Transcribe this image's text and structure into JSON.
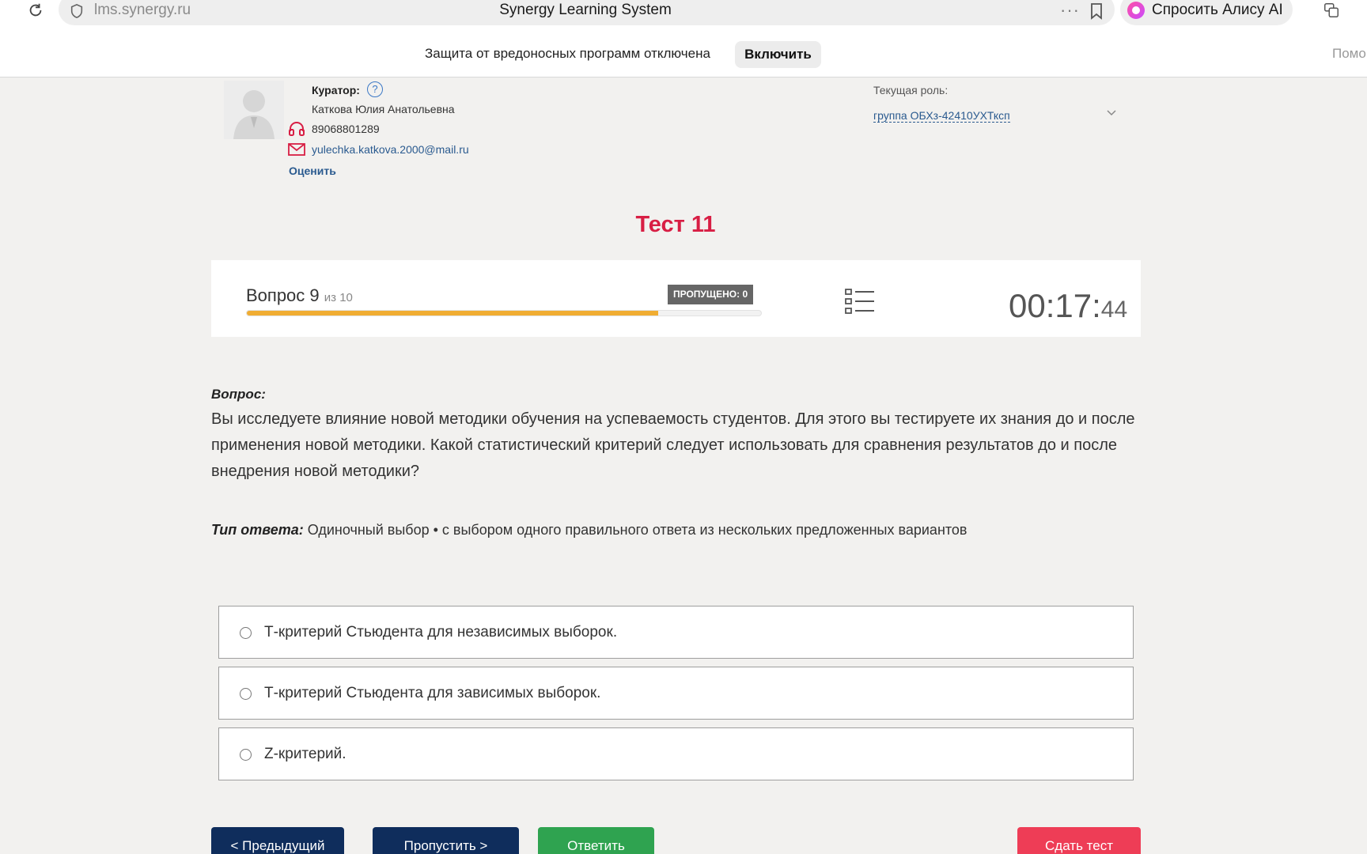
{
  "browser": {
    "url": "lms.synergy.ru",
    "page_title": "Synergy Learning System",
    "more_label": "···",
    "alice_label": "Спросить Алису AI",
    "protection_text": "Защита от вредоносных программ отключена",
    "protection_button": "Включить",
    "help_cut": "Помо"
  },
  "curator": {
    "label": "Куратор:",
    "help": "?",
    "name": "Каткова Юлия Анатольевна",
    "phone": "89068801289",
    "email": "yulechka.katkova.2000@mail.ru",
    "rate": "Оценить"
  },
  "role": {
    "label": "Текущая роль:",
    "value": "группа ОБХз-42410УХТксп"
  },
  "test": {
    "title": "Тест 11"
  },
  "progress": {
    "question_label": "Вопрос 9",
    "question_of": "из 10",
    "skipped": "ПРОПУЩЕНО: 0",
    "fill_fraction": 0.8,
    "timer_main": "00:17:",
    "timer_seconds": "44"
  },
  "question": {
    "heading": "Вопрос:",
    "text": "Вы исследуете влияние новой методики обучения на успеваемость студентов. Для этого вы тестируете их знания до и после применения новой методики. Какой статистический критерий следует использовать для сравнения результатов до и после внедрения новой методики?",
    "answer_type_label": "Тип ответа:",
    "answer_type_value": " Одиночный выбор • с выбором одного правильного ответа из нескольких предложенных вариантов"
  },
  "options": [
    "Т-критерий Стьюдента для независимых выборок.",
    "Т-критерий Стьюдента для зависимых выборок.",
    "Z-критерий."
  ],
  "buttons": {
    "prev": "< Предыдущий",
    "skip": "Пропустить >",
    "answer": "Ответить",
    "submit": "Сдать тест"
  },
  "colors": {
    "title_red": "#d81e44",
    "navy": "#0f2d5c",
    "green": "#2fa350",
    "pink": "#ee3d56",
    "progress": "#f0ad32"
  }
}
